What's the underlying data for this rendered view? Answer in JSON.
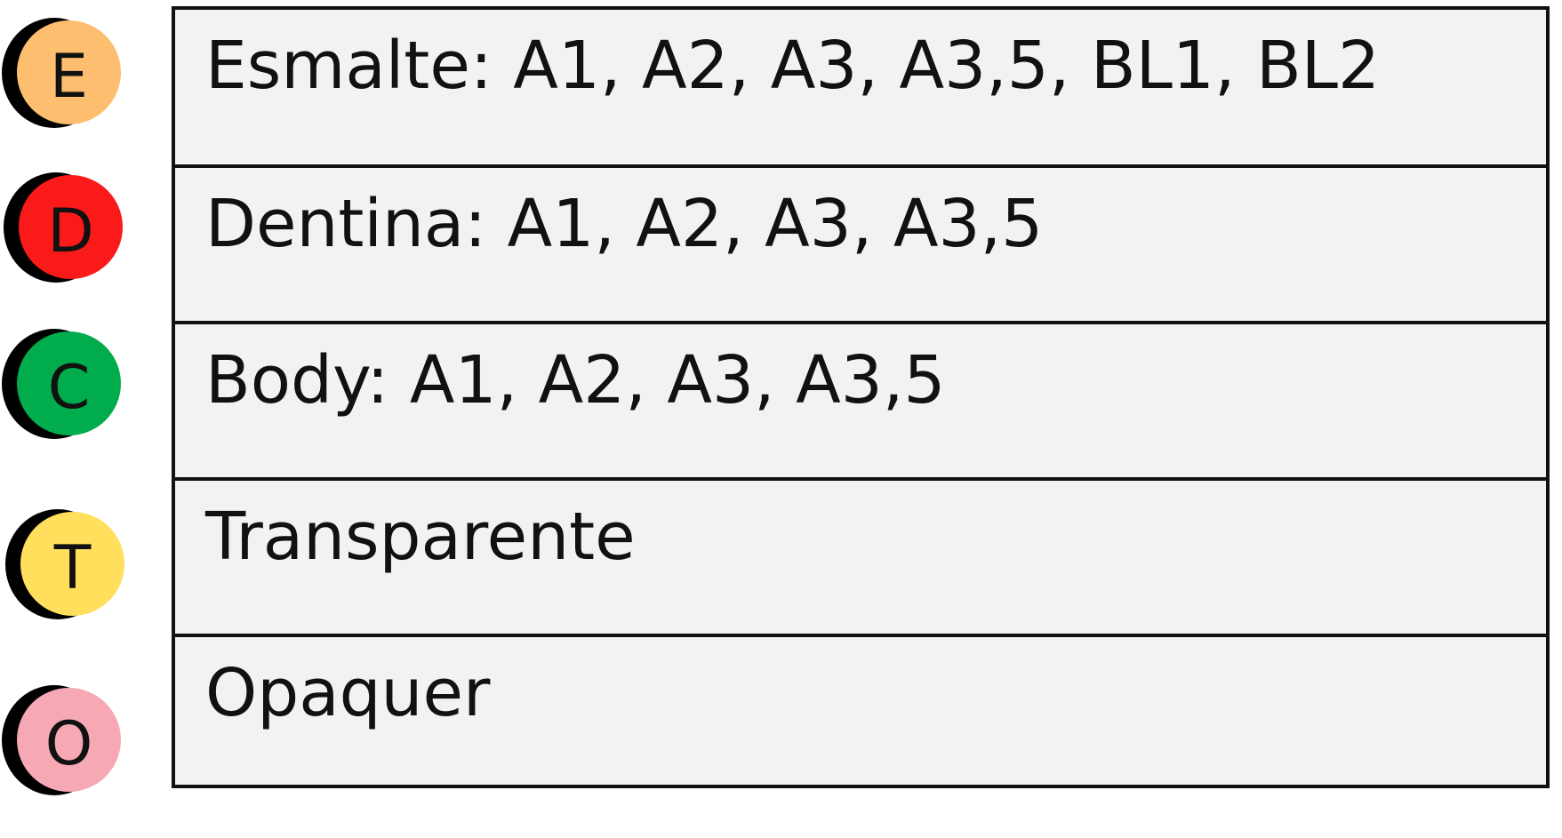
{
  "rows": [
    {
      "badge_letter": "E",
      "badge_color": "#fdbf6f",
      "text": "Esmalte: A1, A2, A3, A3,5, BL1, BL2"
    },
    {
      "badge_letter": "D",
      "badge_color": "#fb1a1a",
      "text": "Dentina: A1, A2, A3, A3,5"
    },
    {
      "badge_letter": "C",
      "badge_color": "#00ac4c",
      "text": "Body: A1, A2, A3, A3,5"
    },
    {
      "badge_letter": "T",
      "badge_color": "#ffdf5c",
      "text": "Transparente"
    },
    {
      "badge_letter": "O",
      "badge_color": "#f6a8b5",
      "text": "Opaquer"
    }
  ],
  "colors": {
    "border": "#111111",
    "row_background": "#f2f2f2",
    "badge_shadow": "#000000"
  }
}
